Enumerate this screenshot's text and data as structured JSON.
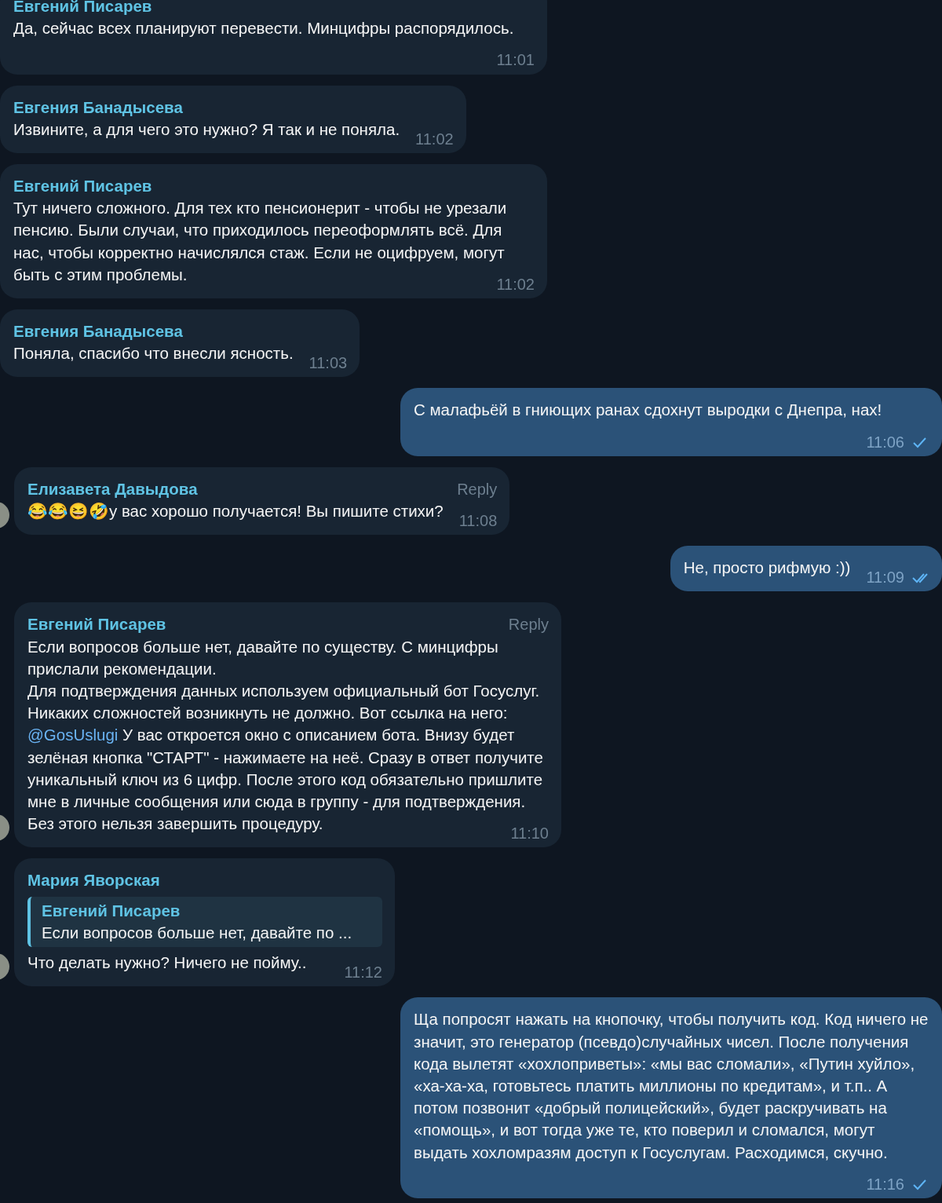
{
  "messages": [
    {
      "kind": "in",
      "author": "Евгений Писарев",
      "parts": [
        {
          "kind": "text",
          "text": "Да, сейчас всех планируют перевести. Минцифры распорядилось."
        }
      ],
      "time": "11:01",
      "avatar": false
    },
    {
      "kind": "in",
      "author": "Евгения Банадысева",
      "parts": [
        {
          "kind": "text",
          "text": "Извините, а для чего это нужно? Я так и не поняла."
        }
      ],
      "time": "11:02",
      "avatar": false
    },
    {
      "kind": "in",
      "author": "Евгений Писарев",
      "parts": [
        {
          "kind": "text",
          "text": "Тут ничего сложного. Для тех кто пенсионерит - чтобы не урезали пенсию. Были случаи, что приходилось переоформлять всё. Для нас, чтобы корректно начислялся стаж. Если не оцифруем, могут быть с этим проблемы."
        }
      ],
      "time": "11:02",
      "avatar": false
    },
    {
      "kind": "in",
      "author": "Евгения Банадысева",
      "parts": [
        {
          "kind": "text",
          "text": "Поняла, спасибо что внесли ясность."
        }
      ],
      "time": "11:03",
      "avatar": false
    },
    {
      "kind": "out",
      "parts": [
        {
          "kind": "text",
          "text": "С малафьёй в гниющих ранах сдохнут выродки с Днепра, нах!"
        }
      ],
      "time": "11:06",
      "read": false
    },
    {
      "kind": "in",
      "author": "Елизавета Давыдова",
      "reply": "Reply",
      "parts": [
        {
          "kind": "text",
          "text": "😂😂😆🤣у вас хорошо получается! Вы пишите стихи?"
        }
      ],
      "time": "11:08",
      "avatar": true
    },
    {
      "kind": "out",
      "parts": [
        {
          "kind": "text",
          "text": "Не, просто рифмую :))"
        }
      ],
      "time": "11:09",
      "read": true
    },
    {
      "kind": "in",
      "author": "Евгений Писарев",
      "reply": "Reply",
      "parts": [
        {
          "kind": "text",
          "text": "Если вопросов больше нет, давайте по существу. С минцифры прислали рекомендации.\nДля подтверждения данных используем официальный бот Госуслуг. Никаких сложностей возникнуть не должно. Вот ссылка на него: "
        },
        {
          "kind": "link",
          "text": "@GosUslugi"
        },
        {
          "kind": "text",
          "text": "  У вас откроется окно с описанием бота. Внизу будет зелёная кнопка \"СТАРТ\" - нажимаете на неё. Сразу в ответ получите уникальный ключ из 6 цифр. После этого код обязательно пришлите мне в личные сообщения или сюда в группу - для подтверждения. Без этого нельзя завершить процедуру."
        }
      ],
      "time": "11:10",
      "avatar": true
    },
    {
      "kind": "in",
      "author": "Мария Яворская",
      "quote": {
        "author": "Евгений Писарев",
        "text": "Если вопросов больше нет, давайте по ..."
      },
      "parts": [
        {
          "kind": "text",
          "text": "Что делать нужно? Ничего не пойму.."
        }
      ],
      "time": "11:12",
      "avatar": true
    },
    {
      "kind": "out",
      "parts": [
        {
          "kind": "text",
          "text": "Ща попросят нажать на кнопочку, чтобы получить код. Код ничего не значит, это генератор (псевдо)случайных чисел. После получения кода вылетят «хохлоприветы»: «мы вас сломали», «Путин хуйло», «ха-ха-ха, готовьтесь платить миллионы по кредитам», и т.п.. А потом позвонит «добрый полицейский», будет раскручивать на «помощь», и вот тогда уже те, кто поверил и сломался, могут выдать хохломразям доступ к Госуслугам. Расходимся, скучно."
        }
      ],
      "time": "11:16",
      "read": false
    }
  ]
}
